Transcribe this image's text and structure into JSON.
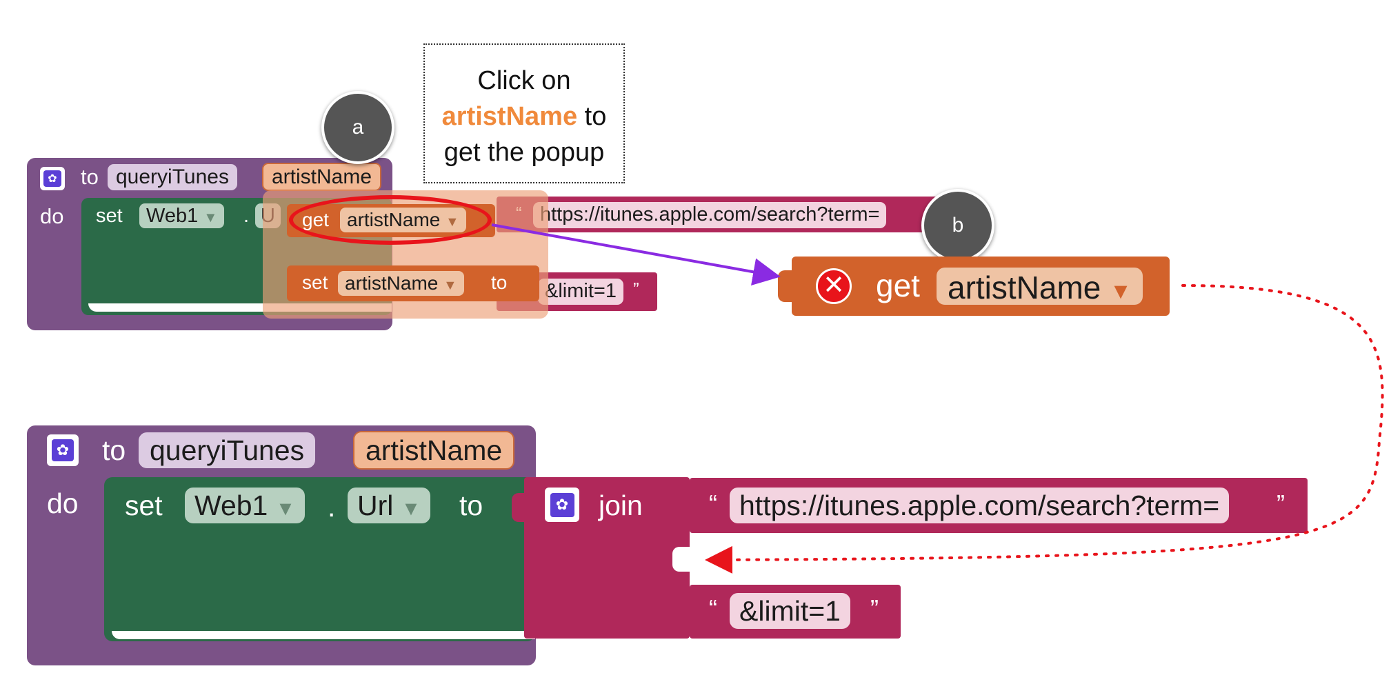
{
  "tooltip": {
    "line1": "Click on",
    "highlight": "artistName",
    "line2_rest": " to",
    "line3": "get the popup"
  },
  "badges": {
    "a": "a",
    "b": "b"
  },
  "top_block": {
    "to_label": "to",
    "proc_name": "queryiTunes",
    "param": "artistName",
    "do_label": "do",
    "set_label": "set",
    "component": "Web1",
    "dot": ".",
    "url_stub": "U",
    "popup_get": {
      "get": "get",
      "var": "artistName"
    },
    "popup_set": {
      "set": "set",
      "var": "artistName",
      "to": "to"
    },
    "url_text": "https://itunes.apple.com/search?term=",
    "limit_text": "&limit=1",
    "open_quote": "“",
    "close_quote": "”"
  },
  "dragged_block": {
    "get": "get",
    "var": "artistName"
  },
  "bottom_block": {
    "to_label": "to",
    "proc_name": "queryiTunes",
    "param": "artistName",
    "do_label": "do",
    "set_label": "set",
    "component": "Web1",
    "dot": ".",
    "property": "Url",
    "to_kw": "to",
    "join_label": "join",
    "url_text": "https://itunes.apple.com/search?term=",
    "limit_text": "&limit=1",
    "open_quote": "“",
    "close_quote": "”"
  },
  "colors": {
    "procedure": "#7b5287",
    "set_block": "#2b6a48",
    "text_block": "#b0285a",
    "variable_block": "#d2622b",
    "highlight_text": "#f08a3c",
    "annotation_red": "#e8141b",
    "connector_purple": "#8a2be2"
  },
  "icons": [
    "gear-icon",
    "dropdown-arrow-icon",
    "error-x-icon"
  ]
}
